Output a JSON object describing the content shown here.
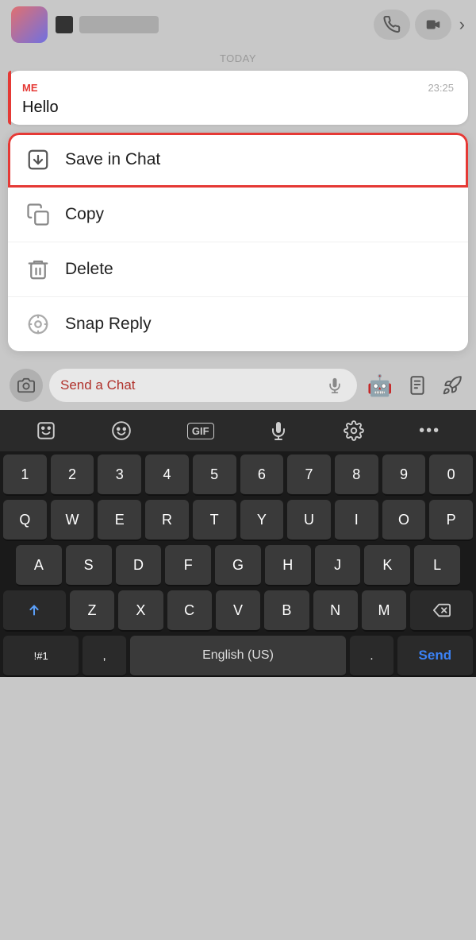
{
  "topbar": {
    "avatar_alt": "avatar",
    "square_alt": "status-indicator",
    "name_placeholder": "Name",
    "phone_icon": "📞",
    "video_icon": "🎥",
    "chevron": "›"
  },
  "chat": {
    "today_label": "TODAY",
    "message": {
      "sender": "ME",
      "time": "23:25",
      "text": "Hello"
    }
  },
  "context_menu": {
    "items": [
      {
        "id": "save-in-chat",
        "label": "Save in Chat",
        "highlighted": true
      },
      {
        "id": "copy",
        "label": "Copy",
        "highlighted": false
      },
      {
        "id": "delete",
        "label": "Delete",
        "highlighted": false
      },
      {
        "id": "snap-reply",
        "label": "Snap Reply",
        "highlighted": false
      }
    ]
  },
  "input_area": {
    "placeholder": "Send a Chat",
    "camera_icon": "⊙",
    "microphone_icon": "🎤",
    "sticker_icon": "🤖",
    "clipboard_icon": "📋",
    "rocket_icon": "🚀"
  },
  "keyboard": {
    "toolbar": {
      "emoji_icon": "☺",
      "smiley_icon": "😊",
      "gif_label": "GIF",
      "mic_icon": "🎤",
      "settings_icon": "⚙",
      "more_icon": "···"
    },
    "rows": [
      [
        "1",
        "2",
        "3",
        "4",
        "5",
        "6",
        "7",
        "8",
        "9",
        "0"
      ],
      [
        "Q",
        "W",
        "E",
        "R",
        "T",
        "Y",
        "U",
        "I",
        "O",
        "P"
      ],
      [
        "A",
        "S",
        "D",
        "F",
        "G",
        "H",
        "J",
        "K",
        "L"
      ],
      [
        "⇧",
        "Z",
        "X",
        "C",
        "V",
        "B",
        "N",
        "M",
        "⌫"
      ],
      [
        "!#1",
        ",",
        "English (US)",
        ".",
        "Send"
      ]
    ]
  },
  "colors": {
    "accent_red": "#e53935",
    "blue_send": "#3b82f6",
    "highlight_border": "#e53935"
  }
}
